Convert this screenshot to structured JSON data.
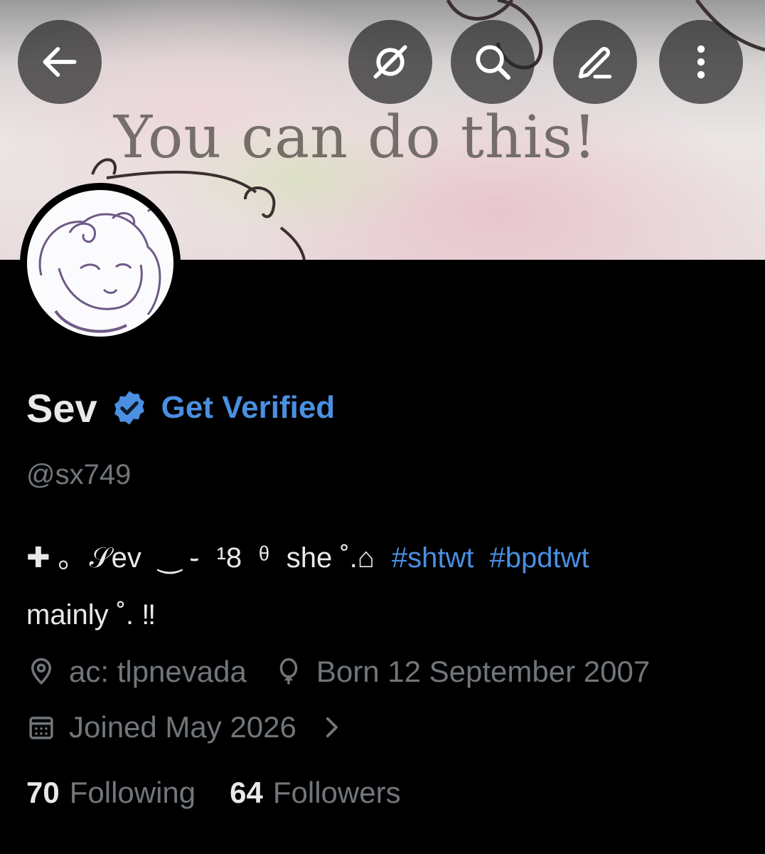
{
  "banner": {
    "text": "You can do this!"
  },
  "toolbar": {
    "back_icon": "arrow-left-icon",
    "grok_icon": "grok-icon",
    "search_icon": "search-icon",
    "edit_icon": "pencil-icon",
    "more_icon": "more-vertical-icon"
  },
  "profile": {
    "name": "Sev",
    "verified_badge_icon": "verified-badge-icon",
    "get_verified_label": "Get Verified",
    "handle": "@sx749",
    "bio": {
      "line1_parts": [
        "✚ ｡",
        "𝒮ev",
        "‿ ֊",
        "¹8",
        "ᶿ",
        "she ˚.⌂"
      ],
      "hashtags": [
        "#shtwt",
        "#bpdtwt"
      ],
      "line2": "mainly ˚. ‼"
    },
    "location": "ac: tlpnevada",
    "birthday": "Born 12 September 2007",
    "joined": "Joined May 2026",
    "following_count": "70",
    "following_label": "Following",
    "followers_count": "64",
    "followers_label": "Followers"
  },
  "colors": {
    "background": "#000000",
    "accent": "#4a8fe0",
    "secondary_text": "#71767b",
    "primary_text": "#e7e9ea"
  }
}
